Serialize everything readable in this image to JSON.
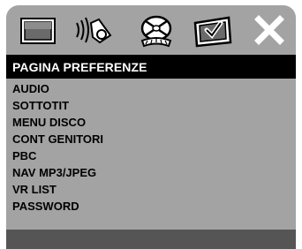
{
  "tabs": [
    {
      "icon": "tv-screen-icon"
    },
    {
      "icon": "speaker-sound-icon"
    },
    {
      "icon": "disc-icon"
    },
    {
      "icon": "preferences-check-icon"
    },
    {
      "icon": "close-icon"
    }
  ],
  "header": {
    "title": "PAGINA PREFERENZE"
  },
  "menu": {
    "items": [
      {
        "label": "AUDIO"
      },
      {
        "label": "SOTTOTIT"
      },
      {
        "label": "MENU DISCO"
      },
      {
        "label": "CONT GENITORI"
      },
      {
        "label": "PBC"
      },
      {
        "label": "NAV MP3/JPEG"
      },
      {
        "label": "VR LIST"
      },
      {
        "label": "PASSWORD"
      }
    ]
  },
  "colors": {
    "panel": "#a3a3a3",
    "header_bg": "#000000",
    "footer": "#555555",
    "icon_fill": "#ffffff"
  }
}
